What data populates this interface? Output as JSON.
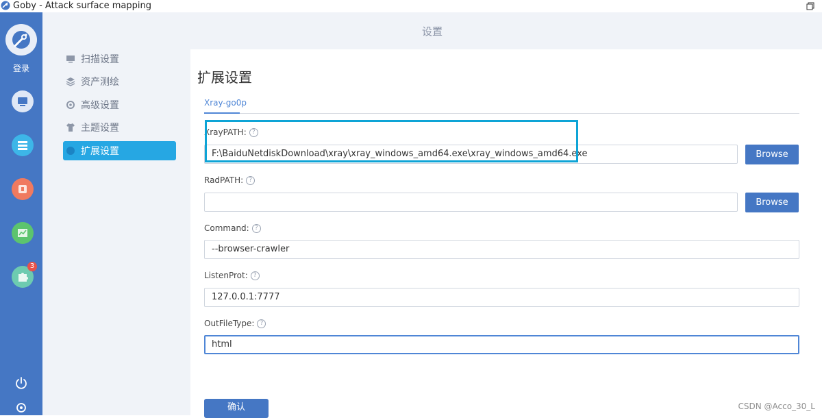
{
  "window": {
    "title": "Goby - Attack surface mapping"
  },
  "rail": {
    "login_label": "登录",
    "badge_count": "3",
    "nav_colors": [
      "#e8f0fb",
      "#3db6e8",
      "#f07a5f",
      "#5cc46e",
      "#6dcbb0"
    ]
  },
  "header": {
    "title": "设置"
  },
  "menu": {
    "items": [
      {
        "label": "扫描设置",
        "icon": "monitor-icon"
      },
      {
        "label": "资产测绘",
        "icon": "layers-icon"
      },
      {
        "label": "高级设置",
        "icon": "gear-icon"
      },
      {
        "label": "主题设置",
        "icon": "shirt-icon"
      },
      {
        "label": "扩展设置",
        "icon": "puzzle-icon",
        "active": true
      }
    ]
  },
  "section": {
    "title": "扩展设置",
    "tab": "Xray-go0p"
  },
  "form": {
    "xraypath": {
      "label": "XrayPATH:",
      "value": "F:\\BaiduNetdiskDownload\\xray\\xray_windows_amd64.exe\\xray_windows_amd64.exe"
    },
    "radpath": {
      "label": "RadPATH:",
      "value": ""
    },
    "command": {
      "label": "Command:",
      "value": "--browser-crawler"
    },
    "listenprot": {
      "label": "ListenProt:",
      "value": "127.0.0.1:7777"
    },
    "outfiletype": {
      "label": "OutFileType:",
      "value": "html"
    },
    "browse_label": "Browse",
    "help_glyph": "?"
  },
  "confirm_label": "确认",
  "watermark": "CSDN @Acco_30_L"
}
